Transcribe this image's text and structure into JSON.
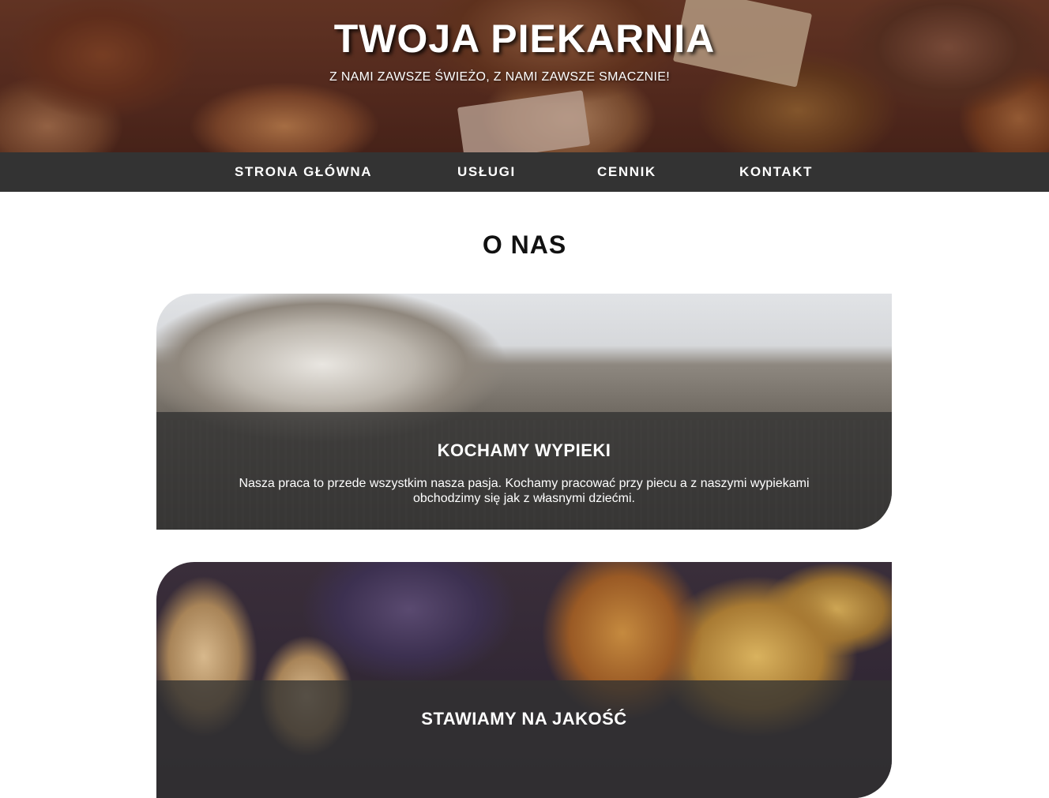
{
  "header": {
    "title": "TWOJA PIEKARNIA",
    "subtitle": "Z NAMI ZAWSZE ŚWIEŻO, Z NAMI ZAWSZE SMACZNIE!"
  },
  "nav": {
    "items": [
      {
        "label": "STRONA GŁÓWNA"
      },
      {
        "label": "USŁUGI"
      },
      {
        "label": "CENNIK"
      },
      {
        "label": "KONTAKT"
      }
    ]
  },
  "about": {
    "title": "O NAS",
    "cards": [
      {
        "heading": "KOCHAMY WYPIEKI",
        "text": "Nasza praca to przede wszystkim nasza pasja. Kochamy pracować przy piecu a z naszymi wypiekami obchodzimy się jak z własnymi dziećmi."
      },
      {
        "heading": "STAWIAMY NA JAKOŚĆ",
        "text": ""
      }
    ]
  }
}
